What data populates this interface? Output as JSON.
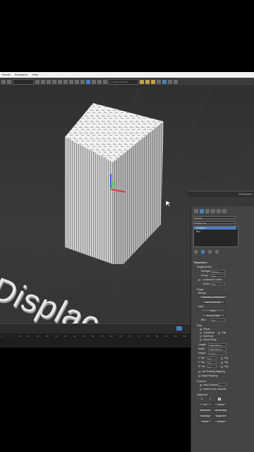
{
  "menu": {
    "items": [
      "Arnold",
      "Substance",
      "Help"
    ]
  },
  "toolbar": {
    "field1": "",
    "field2": "C:\\Users\\Autodesk"
  },
  "viewport": {
    "label": "Displac"
  },
  "timeline": {
    "ticks": [
      "0",
      "5",
      "10",
      "15",
      "20",
      "25",
      "30",
      "35",
      "40",
      "45",
      "50",
      "55",
      "60",
      "65",
      "70",
      "75",
      "80",
      "85",
      "90",
      "95",
      "100"
    ]
  },
  "scene": {
    "label": "Workspace"
  },
  "panel": {
    "object_name": "Box001",
    "modifier_list": "Modifier List",
    "stack": [
      "Displace",
      "Box"
    ],
    "parameters_title": "Parameters",
    "displacement": "Displacement:",
    "strength_label": "Strength:",
    "strength_value": "0.0mm",
    "decay_label": "Decay:",
    "decay_value": "0.0",
    "luminance_center": "Luminance Center",
    "center_label": "Center:",
    "center_value": "0.5",
    "image_title": "Image",
    "bitmap_label": "Bitmap:",
    "bitmap_value": "0.5232516_0249975143",
    "remove_bitmap": "Remove Bitmap",
    "map_label": "Map:",
    "map_none": "None",
    "remove_map": "Remove Map",
    "blur_label": "Blur:",
    "blur_value": "0.0",
    "map_title": "Map:",
    "planar": "Planar",
    "cylindrical": "Cylindrical",
    "cap": "Cap",
    "spherical": "Spherical",
    "shrink_wrap": "Shrink Wrap",
    "length_label": "Length:",
    "length_value": "1386.485mm",
    "width_label": "Width:",
    "width_value": "2056.485mm",
    "height_label": "Height:",
    "height_value": "0.0mm",
    "u_tile": "U Tile:",
    "u_value": "1.0",
    "v_tile": "V Tile:",
    "v_value": "1.0",
    "w_tile": "W Tile:",
    "w_value": "1.0",
    "flip": "Flip",
    "use_existing": "Use Existing Mapping",
    "apply_mapping": "Apply Mapping",
    "channel_title": "Channel:",
    "map_channel": "Map Channel:",
    "map_channel_value": "1",
    "vertex_color": "Vertex Color Channel",
    "alignment_title": "Alignment:",
    "align_x": "X",
    "align_y": "Y",
    "align_z": "Z",
    "btn_fit": "Fit",
    "btn_center": "Center",
    "btn_bitmap_fit": "Bitmap Fit",
    "btn_normal_align": "Normal Align",
    "btn_view_align": "View Align",
    "btn_region_fit": "Region Fit",
    "btn_reset": "Reset",
    "btn_acquire": "Acquire"
  },
  "colors": {
    "accent": "#4a7fbf",
    "panel": "#444444",
    "viewport": "#333333"
  }
}
